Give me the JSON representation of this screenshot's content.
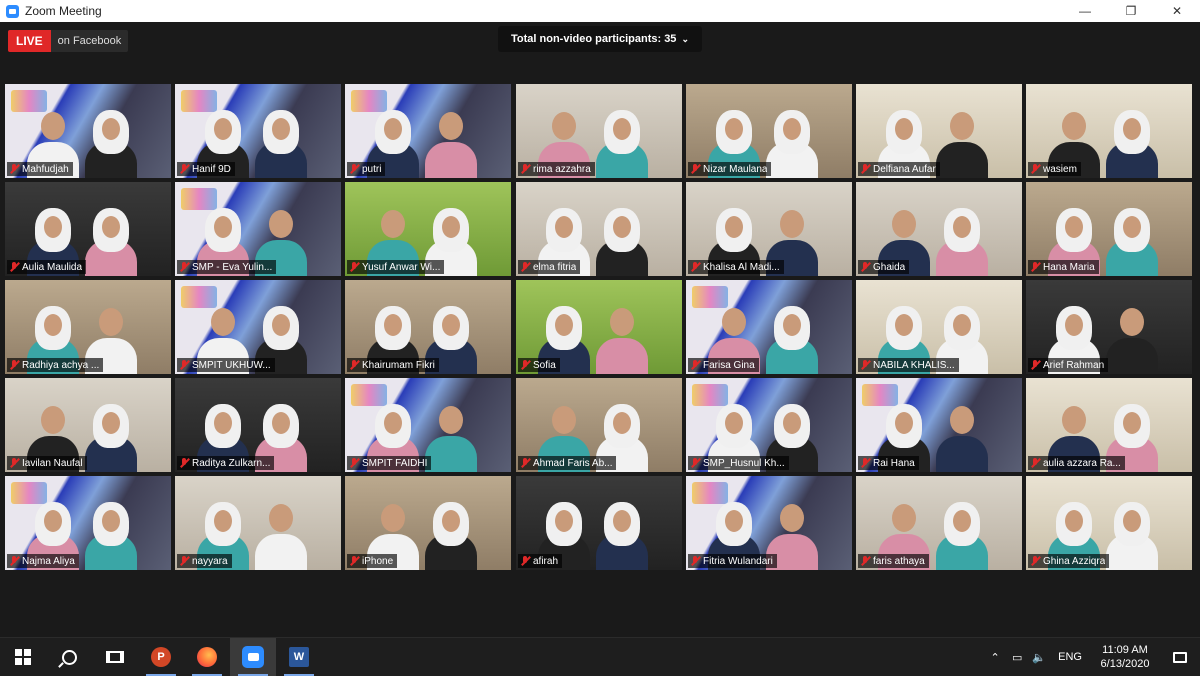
{
  "window": {
    "title": "Zoom Meeting",
    "controls": {
      "minimize": "—",
      "maximize": "❐",
      "close": "✕"
    }
  },
  "meeting": {
    "live_label": "LIVE",
    "live_destination": "on Facebook",
    "non_video_banner": "Total non-video participants: 35",
    "banner_chevron": "⌄"
  },
  "participants": [
    {
      "name": "Mahfudjah",
      "bg": "banner"
    },
    {
      "name": "Hanif 9D",
      "bg": "banner"
    },
    {
      "name": "putri",
      "bg": "banner"
    },
    {
      "name": "rima azzahra",
      "bg": "wall"
    },
    {
      "name": "Nizar Maulana",
      "bg": "room"
    },
    {
      "name": "Delfiana Aufar",
      "bg": "window"
    },
    {
      "name": "wasiem",
      "bg": "window"
    },
    {
      "name": "Aulia Maulida",
      "bg": "dark"
    },
    {
      "name": "SMP - Eva Yulin...",
      "bg": "banner"
    },
    {
      "name": "Yusuf Anwar Wi...",
      "bg": "green"
    },
    {
      "name": "elma fitria",
      "bg": "wall"
    },
    {
      "name": "Khalisa Al Madi...",
      "bg": "wall"
    },
    {
      "name": "Ghaida",
      "bg": "wall"
    },
    {
      "name": "Hana Maria",
      "bg": "room"
    },
    {
      "name": "Radhiya achya ...",
      "bg": "room"
    },
    {
      "name": "SMPIT UKHUW...",
      "bg": "banner"
    },
    {
      "name": "Khairumam Fikri",
      "bg": "room"
    },
    {
      "name": "Sofia",
      "bg": "green"
    },
    {
      "name": "Farisa Gina",
      "bg": "banner"
    },
    {
      "name": "NABILA KHALIS...",
      "bg": "window"
    },
    {
      "name": "Arief Rahman",
      "bg": "dark"
    },
    {
      "name": "Iavilan Naufal",
      "bg": "wall"
    },
    {
      "name": "Raditya Zulkarn...",
      "bg": "dark"
    },
    {
      "name": "SMPIT FAIDHI",
      "bg": "banner"
    },
    {
      "name": "Ahmad Faris Ab...",
      "bg": "room"
    },
    {
      "name": "SMP_Husnul Kh...",
      "bg": "banner"
    },
    {
      "name": "Rai Hana",
      "bg": "banner"
    },
    {
      "name": "aulia azzara Ra...",
      "bg": "window"
    },
    {
      "name": "Najma Aliya",
      "bg": "banner"
    },
    {
      "name": "nayyara",
      "bg": "wall"
    },
    {
      "name": "iPhone",
      "bg": "room"
    },
    {
      "name": "afirah",
      "bg": "dark"
    },
    {
      "name": "Fitria Wulandari",
      "bg": "banner"
    },
    {
      "name": "faris athaya",
      "bg": "wall"
    },
    {
      "name": "Ghina Azziqra",
      "bg": "window"
    }
  ],
  "taskbar": {
    "apps": [
      {
        "icon": "windows-start-icon"
      },
      {
        "icon": "search-icon"
      },
      {
        "icon": "task-view-icon"
      },
      {
        "icon": "powerpoint-icon",
        "label": "P"
      },
      {
        "icon": "firefox-icon"
      },
      {
        "icon": "zoom-icon"
      },
      {
        "icon": "word-icon",
        "label": "W"
      }
    ],
    "tray": {
      "chevron": "⌃",
      "network": "▭",
      "volume": "🔈",
      "language": "ENG",
      "time": "11:09 AM",
      "date": "6/13/2020"
    }
  }
}
